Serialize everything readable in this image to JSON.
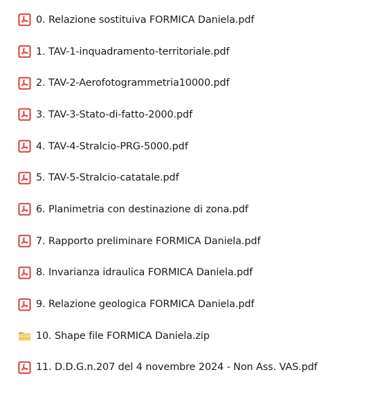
{
  "explorer": {
    "files": [
      {
        "name": "0. Relazione sostituiva FORMICA Daniela.pdf",
        "icon": "pdf-icon"
      },
      {
        "name": "1. TAV-1-inquadramento-territoriale.pdf",
        "icon": "pdf-icon"
      },
      {
        "name": "2. TAV-2-Aerofotogrammetria10000.pdf",
        "icon": "pdf-icon"
      },
      {
        "name": "3. TAV-3-Stato-di-fatto-2000.pdf",
        "icon": "pdf-icon"
      },
      {
        "name": "4. TAV-4-Stralcio-PRG-5000.pdf",
        "icon": "pdf-icon"
      },
      {
        "name": "5. TAV-5-Stralcio-catatale.pdf",
        "icon": "pdf-icon"
      },
      {
        "name": "6. Planimetria con destinazione di zona.pdf",
        "icon": "pdf-icon"
      },
      {
        "name": "7. Rapporto preliminare FORMICA Daniela.pdf",
        "icon": "pdf-icon"
      },
      {
        "name": "8. Invarianza idraulica FORMICA Daniela.pdf",
        "icon": "pdf-icon"
      },
      {
        "name": "9. Relazione geologica FORMICA Daniela.pdf",
        "icon": "pdf-icon"
      },
      {
        "name": "10. Shape file FORMICA Daniela.zip",
        "icon": "zip-folder-icon"
      },
      {
        "name": "11. D.D.G.n.207 del 4 novembre 2024 - Non Ass. VAS.pdf",
        "icon": "pdf-icon"
      }
    ],
    "colors": {
      "pdf_red": "#d9352c",
      "zip_yellow": "#f2c447"
    }
  }
}
